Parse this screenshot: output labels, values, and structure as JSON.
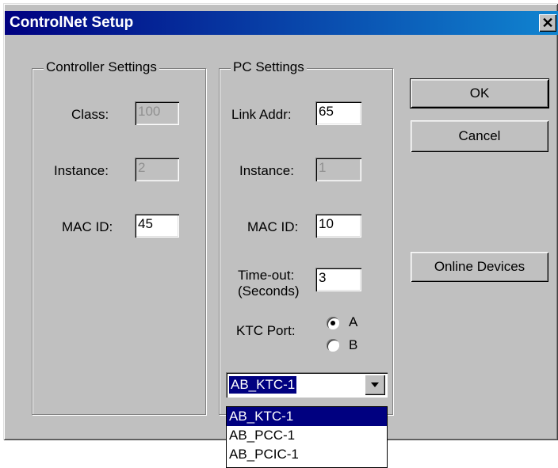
{
  "window": {
    "title": "ControlNet Setup",
    "close_label": "✕"
  },
  "controller": {
    "group_label": "Controller Settings",
    "class_label": "Class:",
    "class_value": "100",
    "instance_label": "Instance:",
    "instance_value": "2",
    "macid_label": "MAC ID:",
    "macid_value": "45"
  },
  "pc": {
    "group_label": "PC Settings",
    "link_label": "Link Addr:",
    "link_value": "65",
    "instance_label": "Instance:",
    "instance_value": "1",
    "macid_label": "MAC ID:",
    "macid_value": "10",
    "timeout_label_1": "Time-out:",
    "timeout_label_2": "(Seconds)",
    "timeout_value": "3",
    "ktc_label": "KTC Port:",
    "port_a": "A",
    "port_b": "B",
    "port_selected": "A"
  },
  "buttons": {
    "ok": "OK",
    "cancel": "Cancel",
    "online": "Online Devices"
  },
  "combo": {
    "selected": "AB_KTC-1",
    "options": [
      "AB_KTC-1",
      "AB_PCC-1",
      "AB_PCIC-1"
    ]
  }
}
